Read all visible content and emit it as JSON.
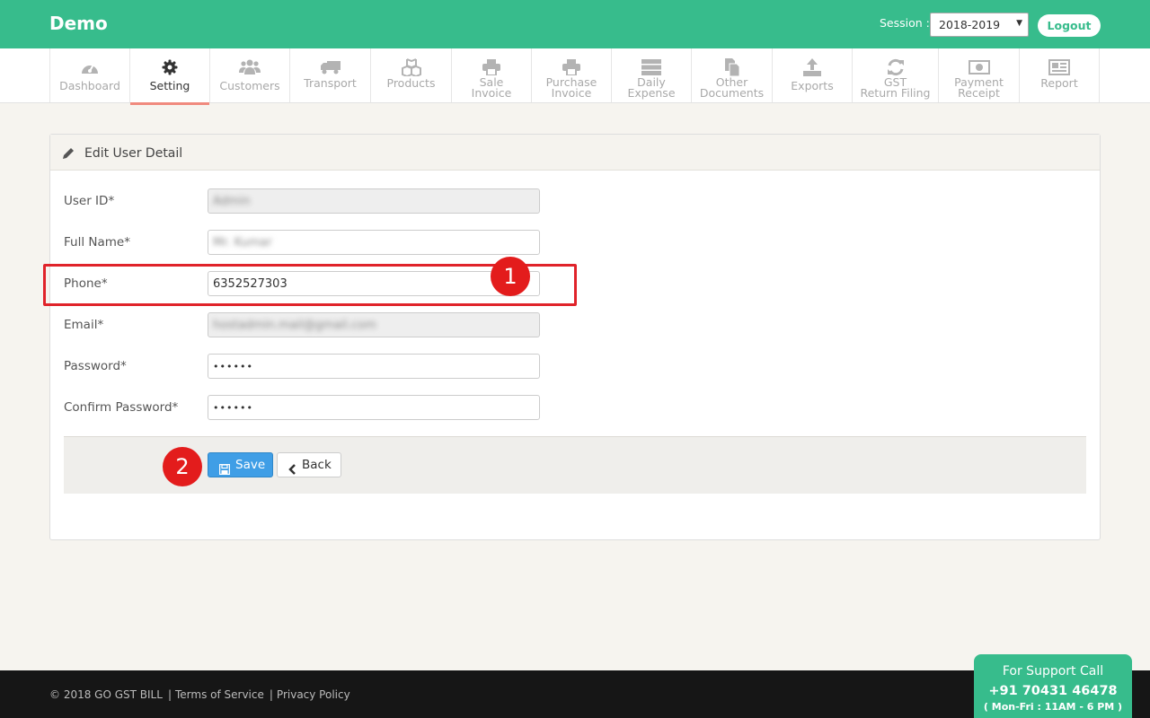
{
  "header": {
    "brand": "Demo",
    "session_label": "Session :",
    "session_value": "2018-2019",
    "logout": "Logout"
  },
  "nav": [
    {
      "label": "Dashboard",
      "icon": "dashboard-icon"
    },
    {
      "label": "Setting",
      "icon": "gear-icon",
      "active": true
    },
    {
      "label": "Customers",
      "icon": "users-icon"
    },
    {
      "label": "Transport",
      "icon": "truck-icon"
    },
    {
      "label": "Products",
      "icon": "cubes-icon"
    },
    {
      "label1": "Sale",
      "label2": "Invoice",
      "icon": "printer-icon"
    },
    {
      "label1": "Purchase",
      "label2": "Invoice",
      "icon": "printer-icon"
    },
    {
      "label1": "Daily",
      "label2": "Expense",
      "icon": "server-icon"
    },
    {
      "label1": "Other",
      "label2": "Documents",
      "icon": "documents-icon"
    },
    {
      "label": "Exports",
      "icon": "upload-icon"
    },
    {
      "label1": "GST",
      "label2": "Return Filing",
      "icon": "refresh-icon"
    },
    {
      "label1": "Payment",
      "label2": "Receipt",
      "icon": "money-icon"
    },
    {
      "label": "Report",
      "icon": "newspaper-icon"
    }
  ],
  "panel": {
    "title": "Edit User Detail",
    "fields": {
      "user_id": {
        "label": "User ID*",
        "value": "Admin"
      },
      "full_name": {
        "label": "Full Name*",
        "value": "Mr. Kumar"
      },
      "phone": {
        "label": "Phone*",
        "value": "6352527303"
      },
      "email": {
        "label": "Email*",
        "value": "hostadmin.mail@gmail.com"
      },
      "password": {
        "label": "Password*",
        "value": "••••••"
      },
      "confirm_password": {
        "label": "Confirm Password*",
        "value": "••••••"
      }
    },
    "save": "Save",
    "back": "Back"
  },
  "annotations": {
    "badge1": "1",
    "badge2": "2",
    "color": "#e31c1c"
  },
  "footer": {
    "copyright": "© 2018 GO GST BILL",
    "terms": "Terms of Service",
    "privacy": "Privacy Policy"
  },
  "support": {
    "line1": "For Support Call",
    "phone": "+91 70431 46478",
    "hours": "( Mon-Fri : 11AM - 6 PM )"
  },
  "colors": {
    "brand": "#37bc8c",
    "primary": "#3f9ee6",
    "active_tab": "#f08a7e"
  }
}
